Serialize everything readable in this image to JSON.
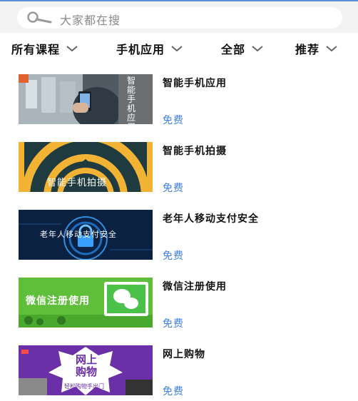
{
  "search": {
    "placeholder": "大家都在搜"
  },
  "filters": [
    {
      "label": "所有课程"
    },
    {
      "label": "手机应用"
    },
    {
      "label": "全部"
    },
    {
      "label": "推荐"
    }
  ],
  "courses": [
    {
      "title": "智能手机应用",
      "price": "免费",
      "thumb_text": "智能手机应用"
    },
    {
      "title": "智能手机拍摄",
      "price": "免费",
      "thumb_text": "智能手机拍摄"
    },
    {
      "title": "老年人移动支付安全",
      "price": "免费",
      "thumb_text": "老年人移动支付安全"
    },
    {
      "title": "微信注册使用",
      "price": "免费",
      "thumb_text": "微信注册使用"
    },
    {
      "title": "网上购物",
      "price": "免费",
      "thumb_text": "网上购物",
      "thumb_subtext": "轻松购物手出门"
    }
  ],
  "colors": {
    "accent": "#3f7fe0",
    "topbar_bg": "#f3f3f3"
  }
}
